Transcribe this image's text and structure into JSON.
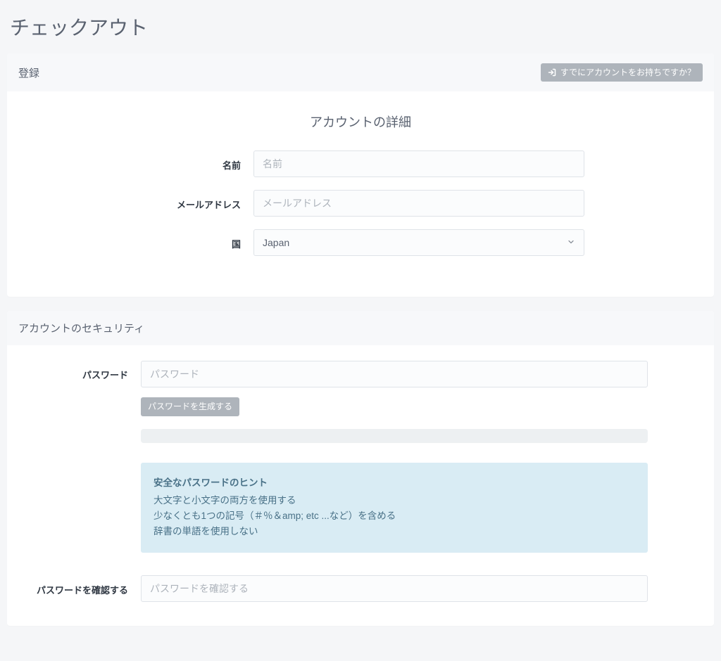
{
  "page": {
    "title": "チェックアウト"
  },
  "register_panel": {
    "header": "登録",
    "already_have_account": "すでにアカウントをお持ちですか？",
    "section_title": "アカウントの詳細",
    "name_label": "名前",
    "name_placeholder": "名前",
    "email_label": "メールアドレス",
    "email_placeholder": "メールアドレス",
    "country_label": "国",
    "country_selected": "Japan"
  },
  "security_panel": {
    "header": "アカウントのセキュリティ",
    "password_label": "パスワード",
    "password_placeholder": "パスワード",
    "generate_button": "パスワードを生成する",
    "hint_title": "安全なパスワードのヒント",
    "hint_line1": "大文字と小文字の両方を使用する",
    "hint_line2": "少なくとも1つの記号（＃％＆amp; etc ...など）を含める",
    "hint_line3": "辞書の単語を使用しない",
    "confirm_label": "パスワードを確認する",
    "confirm_placeholder": "パスワードを確認する"
  }
}
